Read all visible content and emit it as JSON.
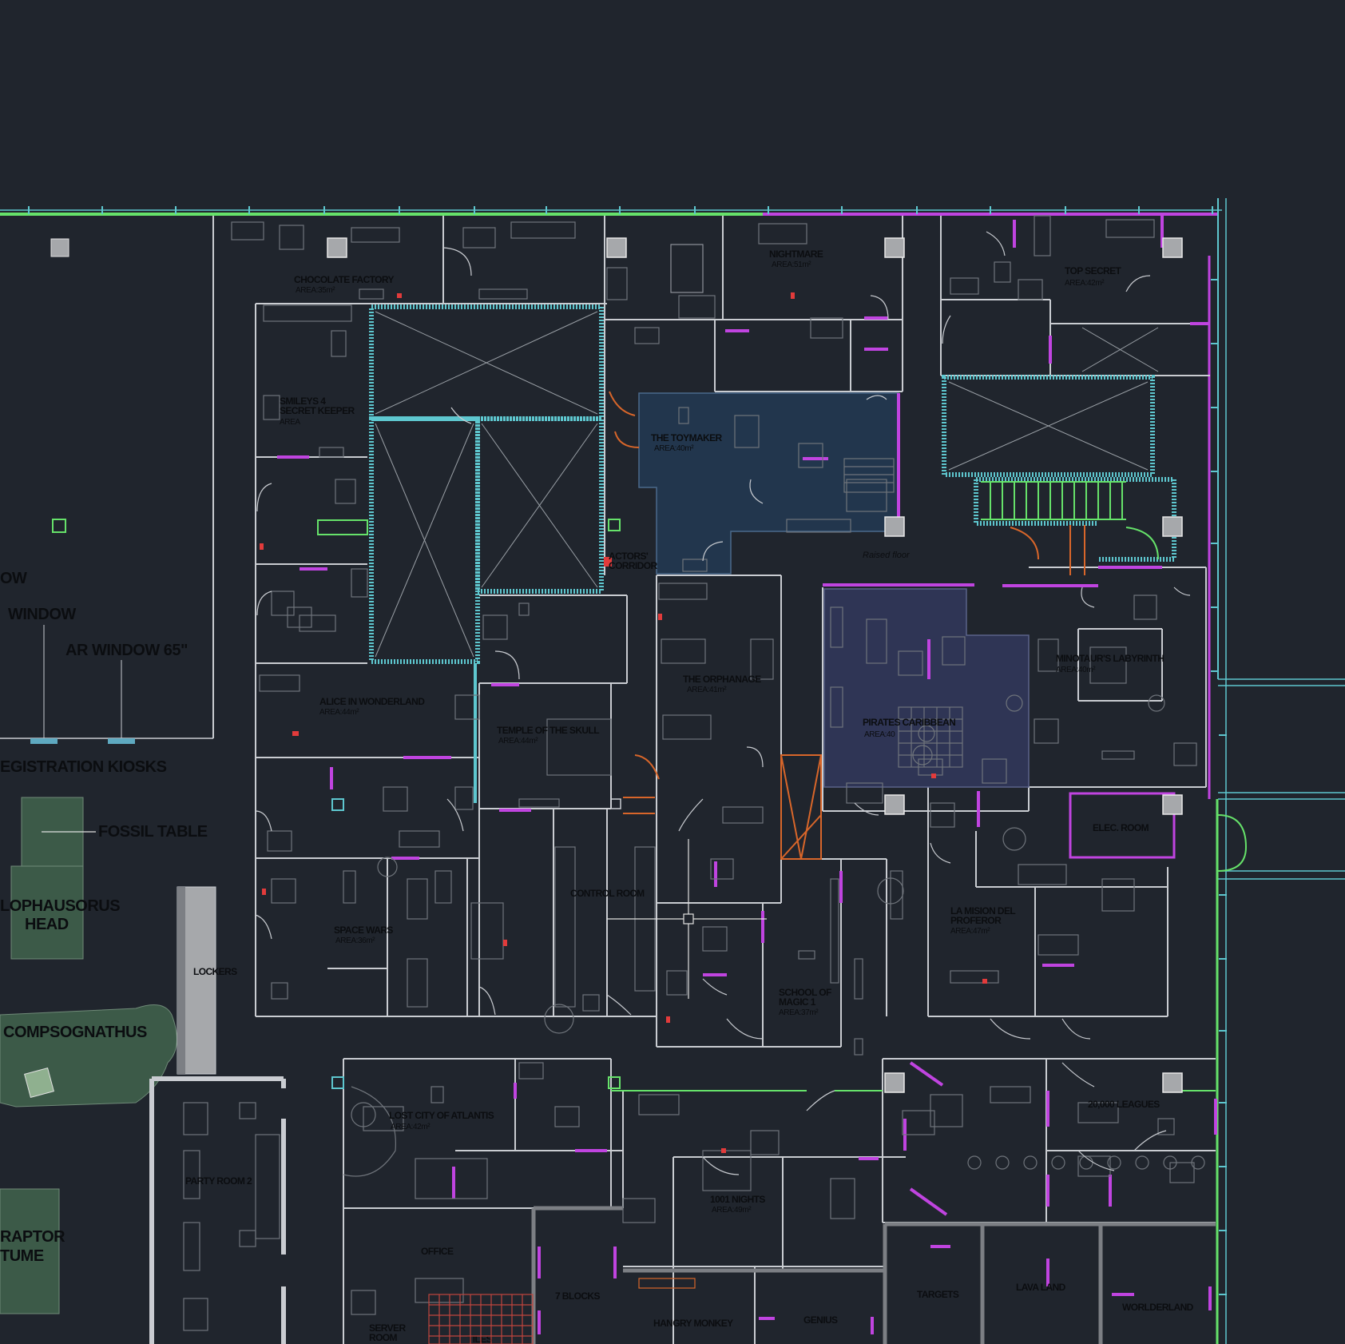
{
  "drawing": {
    "background": "#20252d",
    "colors": {
      "wall": "#c9ccd1",
      "furniture": "#6f747b",
      "glazing": "#5ec7cf",
      "partition": "#c044e0",
      "accent_green": "#66e26a",
      "fire_door": "#d8662a",
      "toymaker_fill": "#22364d",
      "pirates_fill": "#2f3555",
      "exhibit_fill": "#3c5a48",
      "column": "#a6a8ab"
    }
  },
  "rooms": [
    {
      "id": "chocolate-factory",
      "name": "CHOCOLATE FACTORY",
      "area": "AREA:35m²"
    },
    {
      "id": "nightmare",
      "name": "NIGHTMARE",
      "area": "AREA:51m²"
    },
    {
      "id": "top-secret",
      "name": "TOP SECRET",
      "area": "AREA:42m²"
    },
    {
      "id": "smileys",
      "name": "SMILEYS 4",
      "name2": "SECRET KEEPER",
      "area": "AREA"
    },
    {
      "id": "toymaker",
      "name": "THE TOYMAKER",
      "area": "AREA:40m²"
    },
    {
      "id": "actors-corridor",
      "name": "ACTORS'",
      "name2": "CORRIDOR"
    },
    {
      "id": "orphanage",
      "name": "THE ORPHANAGE",
      "area": "AREA:41m²"
    },
    {
      "id": "minotaur",
      "name": "MINOTAUR'S LABYRINTH",
      "area": "AREA:40m²"
    },
    {
      "id": "alice",
      "name": "ALICE IN WONDERLAND",
      "area": "AREA:44m²"
    },
    {
      "id": "temple",
      "name": "TEMPLE OF THE SKULL",
      "area": "AREA:44m²"
    },
    {
      "id": "pirates",
      "name": "PIRATES CARIBBEAN",
      "area": "AREA:40"
    },
    {
      "id": "elec-room",
      "name": "ELEC. ROOM"
    },
    {
      "id": "control-room",
      "name": "CONTROL ROOM"
    },
    {
      "id": "space-wars",
      "name": "SPACE WARS",
      "area": "AREA:36m²"
    },
    {
      "id": "la-mision",
      "name": "LA MISION DEL",
      "name2": "PROFEROR",
      "area": "AREA:47m²"
    },
    {
      "id": "school-magic",
      "name": "SCHOOL OF",
      "name2": "MAGIC 1",
      "area": "AREA:37m²"
    },
    {
      "id": "lockers",
      "name": "LOCKERS"
    },
    {
      "id": "lost-city",
      "name": "LOST CITY OF ATLANTIS",
      "area": "AREA:42m²"
    },
    {
      "id": "leagues",
      "name": "20,000 LEAGUES"
    },
    {
      "id": "party-room",
      "name": "PARTY ROOM 2"
    },
    {
      "id": "nights",
      "name": "1001 NIGHTS",
      "area": "AREA:49m²"
    },
    {
      "id": "office",
      "name": "OFFICE"
    },
    {
      "id": "blocks",
      "name": "7 BLOCKS"
    },
    {
      "id": "targets",
      "name": "TARGETS"
    },
    {
      "id": "lava-land",
      "name": "LAVA LAND"
    },
    {
      "id": "worlderland",
      "name": "WORLDERLAND"
    },
    {
      "id": "hangry",
      "name": "HANGRY MONKEY"
    },
    {
      "id": "genius",
      "name": "GENIUS"
    },
    {
      "id": "server",
      "name": "SERVER",
      "name2": "ROOM"
    },
    {
      "id": "tiles",
      "name": "TILES"
    }
  ],
  "exhibit_labels": {
    "window_left": "OW",
    "window": "WINDOW",
    "ar_window": "AR WINDOW 65\"",
    "kiosks": "EGISTRATION KIOSKS",
    "fossil": "FOSSIL TABLE",
    "head1": "LOPHAUSORUS",
    "head2": "HEAD",
    "compsognathus": "COMPSOGNATHUS",
    "raptor1": "RAPTOR",
    "raptor2": "TUME"
  },
  "notes": {
    "raised_floor": "Raised floor"
  }
}
